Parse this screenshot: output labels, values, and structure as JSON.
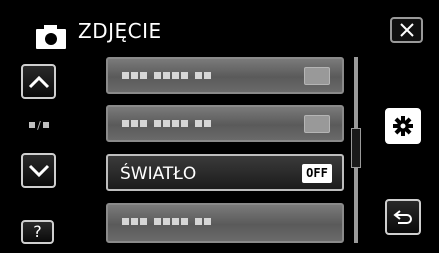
{
  "header": {
    "title": "ZDJĘCIE",
    "mode_icon": "camera-icon"
  },
  "side": {
    "close_icon": "close-icon",
    "up_icon": "arrow-up-icon",
    "down_icon": "arrow-down-icon",
    "help_label": "?",
    "settings_icon": "gear-icon",
    "back_icon": "return-icon",
    "page_indicator_sep": "/"
  },
  "menu": {
    "items": [
      {
        "label": "",
        "masked": true,
        "value_badge": "placeholder"
      },
      {
        "label": "",
        "masked": true,
        "value_badge": "placeholder"
      },
      {
        "label": "ŚWIATŁO",
        "masked": false,
        "value_badge": "OFF",
        "selected": true
      },
      {
        "label": "",
        "masked": true
      }
    ]
  },
  "colors": {
    "background": "#000000",
    "item_bg": "#6a6a6a",
    "active_item_bg": "#1c1c1c",
    "text": "#ffffff"
  }
}
